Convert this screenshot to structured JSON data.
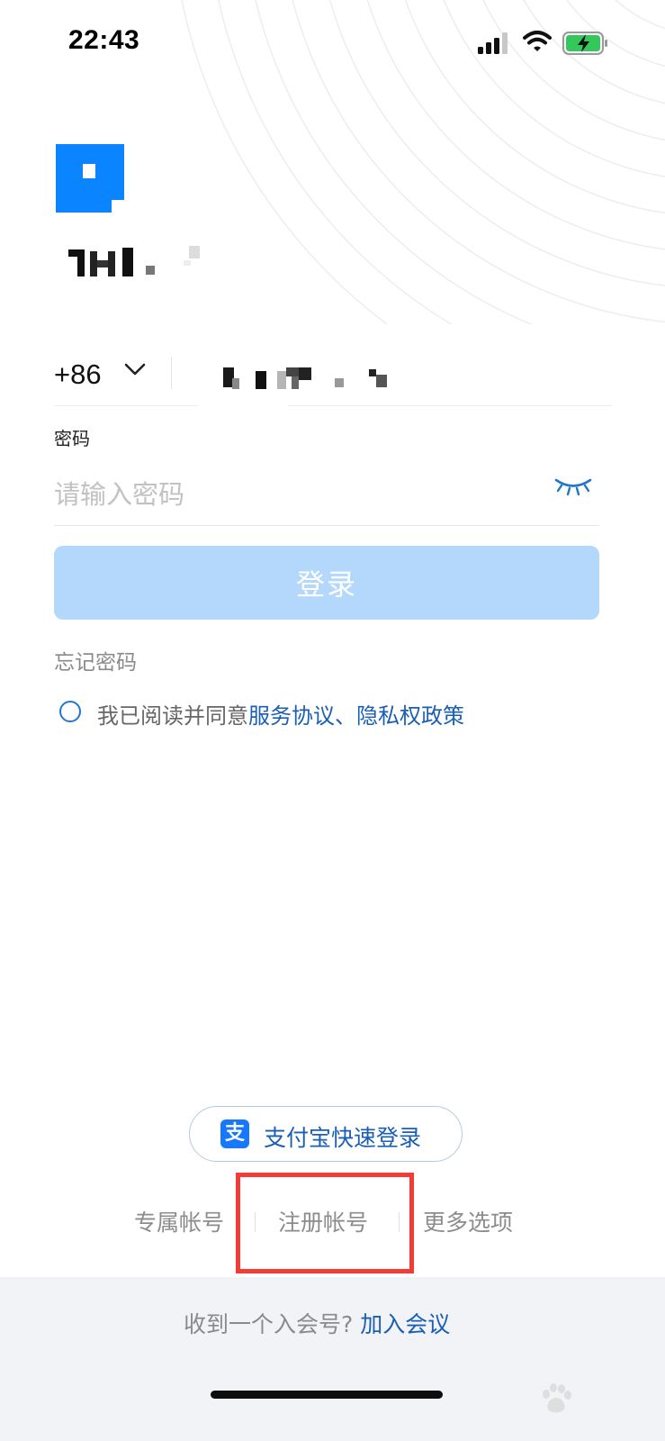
{
  "status_bar": {
    "time": "22:43"
  },
  "login": {
    "country_code": "+86",
    "password_label": "密码",
    "password_placeholder": "请输入密码",
    "login_label": "登录",
    "forgot_password": "忘记密码",
    "agreement": {
      "prefix": "我已阅读并同意",
      "terms_link": "服务协议",
      "separator": "、",
      "privacy_link": "隐私权政策"
    }
  },
  "alternate_login": {
    "alipay_label": "支付宝快速登录",
    "alipay_icon": "alipay-icon"
  },
  "bottom_options": {
    "exclusive_account": "专属帐号",
    "register_account": "注册帐号",
    "more_options": "更多选项"
  },
  "footer": {
    "prompt": "收到一个入会号?",
    "join_link": "加入会议"
  },
  "colors": {
    "accent": "#1a5fb4",
    "login_button_disabled": "#b3d8fb",
    "logo_blue": "#0a84ff",
    "highlight_red": "#f43c37"
  }
}
